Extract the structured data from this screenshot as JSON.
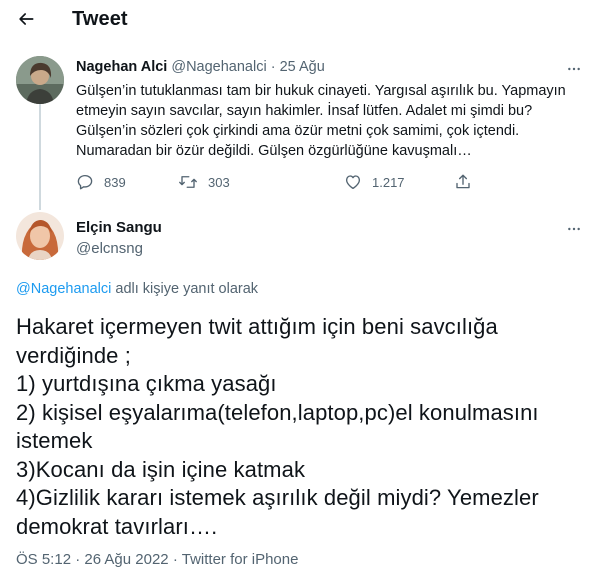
{
  "header": {
    "back_icon": "arrow-left-icon",
    "title": "Tweet"
  },
  "parent_tweet": {
    "author_name": "Nagehan Alci",
    "handle": "@Nagehanalci",
    "separator": "·",
    "date": "25 Ağu",
    "more_icon": "more-horizontal-icon",
    "text_lines": [
      "Gülşen’in tutuklanması tam bir hukuk cinayeti. Yargısal aşırılık bu. Yapmayın",
      "etmeyin sayın savcılar, sayın hakimler. İnsaf lütfen. Adalet mi şimdi bu?",
      "Gülşen’in sözleri çok çirkindi ama özür metni çok samimi, çok içtendi.",
      "Numaradan bir özür değildi. Gülşen özgürlüğüne kavuşmalı…"
    ],
    "replies": "839",
    "retweets": "303",
    "likes": "1.217",
    "icons": {
      "reply": "reply-bubble-icon",
      "retweet": "retweet-icon",
      "like": "heart-icon",
      "share": "share-icon"
    }
  },
  "main_tweet": {
    "author_name": "Elçin Sangu",
    "handle": "@elcnsng",
    "more_icon": "more-horizontal-icon",
    "reply_to_mention": "@Nagehanalci",
    "reply_to_suffix": "adlı kişiye yanıt olarak",
    "text_lines": [
      "Hakaret içermeyen twit attığım için beni savcılığa",
      "verdiğinde ;",
      "1) yurtdışına çıkma yasağı",
      "2) kişisel eşyalarıma(telefon,laptop,pc)el konulmasını",
      "istemek",
      "3)Kocanı da işin içine katmak",
      "4)Gizlilik kararı istemek aşırılık değil miydi? Yemezler",
      "demokrat tavırları…."
    ],
    "time": "ÖS 5:12",
    "date": "26 Ağu 2022",
    "source": "Twitter for iPhone",
    "separator": "·"
  },
  "colors": {
    "text_primary": "#0f1419",
    "text_secondary": "#536471",
    "link": "#1d9bf0",
    "thread_line": "#cfd9de"
  }
}
